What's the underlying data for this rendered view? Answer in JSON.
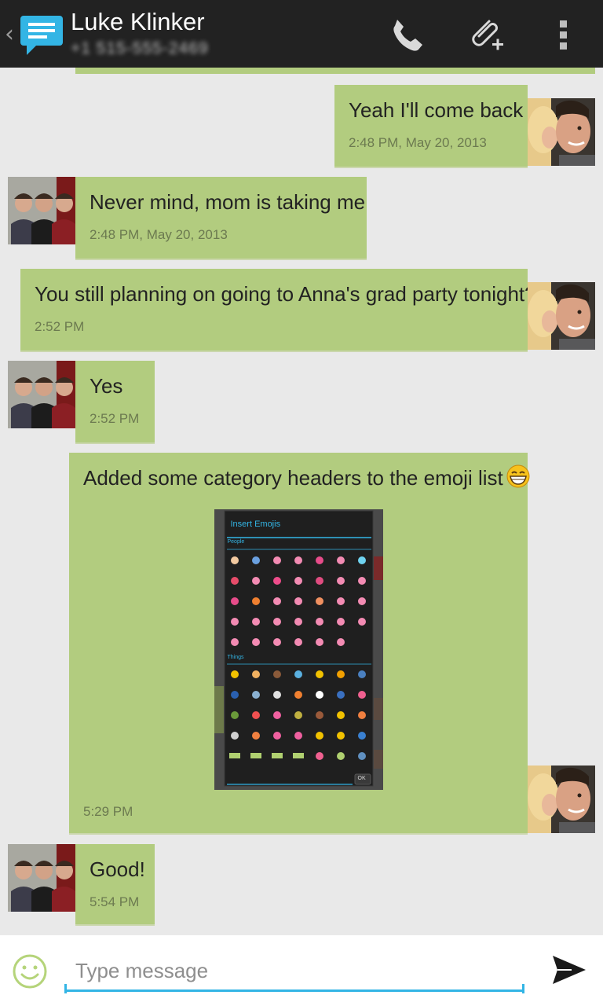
{
  "header": {
    "back_icon": "chevron-left-icon",
    "app_icon": "message-bubble-icon",
    "contact_name": "Luke Klinker",
    "contact_number": "+1 515-555-2469",
    "actions": [
      "phone-icon",
      "attach-plus-icon",
      "overflow-menu-icon"
    ]
  },
  "messages": [
    {
      "direction": "out",
      "text": "Yeah I'll come back",
      "time": "2:48 PM, May 20, 2013"
    },
    {
      "direction": "in",
      "text": "Never mind, mom is taking me",
      "time": "2:48 PM, May 20, 2013"
    },
    {
      "direction": "out",
      "text": "You still planning on going to Anna's grad party tonight?",
      "time": "2:52 PM"
    },
    {
      "direction": "in",
      "text": "Yes",
      "time": "2:52 PM"
    },
    {
      "direction": "out",
      "text": "Added some category headers to the emoji list",
      "time": "5:29 PM",
      "emoji": "grinning-face-icon",
      "attachment": {
        "dialog_title": "Insert Emojis",
        "section_people": "People",
        "section_things": "Things",
        "ok_label": "OK"
      }
    },
    {
      "direction": "in",
      "text": "Good!",
      "time": "5:54 PM"
    }
  ],
  "compose": {
    "emoji_button_icon": "smiley-icon",
    "placeholder": "Type message",
    "send_icon": "send-icon"
  },
  "colors": {
    "action_bar": "#222222",
    "bubble": "#b2cc7f",
    "background": "#e9e9e9",
    "accent": "#33b5e5"
  }
}
